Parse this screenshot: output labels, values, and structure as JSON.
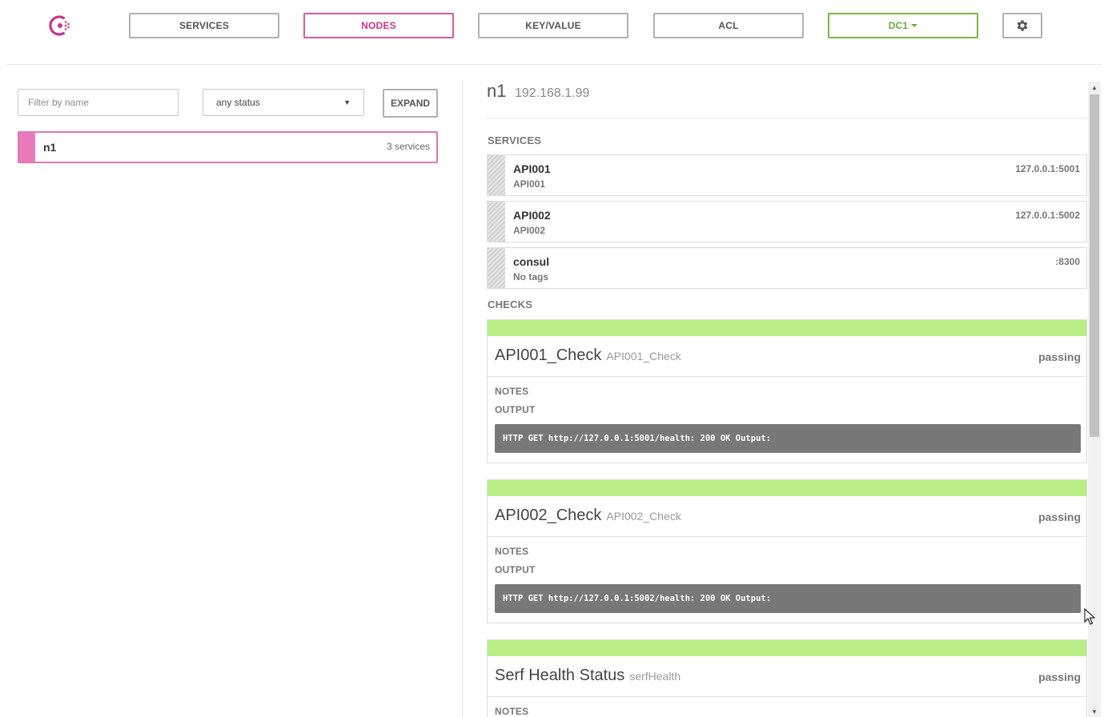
{
  "nav": {
    "services": "SERVICES",
    "nodes": "NODES",
    "keyvalue": "KEY/VALUE",
    "acl": "ACL",
    "datacenter": "DC1"
  },
  "colors": {
    "brand": "#c7358a",
    "active_border": "#d6599e",
    "dc_green": "#6aa93b",
    "passing_bar": "#b9ee87",
    "output_bg": "#787878"
  },
  "filters": {
    "name_placeholder": "Filter by name",
    "status_value": "any status",
    "expand_label": "EXPAND"
  },
  "nodes": [
    {
      "name": "n1",
      "services": "3 services"
    }
  ],
  "detail": {
    "name": "n1",
    "address": "192.168.1.99",
    "services_title": "SERVICES",
    "checks_title": "CHECKS",
    "services": [
      {
        "name": "API001",
        "tags": "API001",
        "address": "127.0.0.1:5001"
      },
      {
        "name": "API002",
        "tags": "API002",
        "address": "127.0.0.1:5002"
      },
      {
        "name": "consul",
        "tags": "No tags",
        "address": ":8300"
      }
    ],
    "checks": [
      {
        "name": "API001_Check",
        "id": "API001_Check",
        "status": "passing",
        "notes_label": "NOTES",
        "output_label": "OUTPUT",
        "output": "HTTP GET http://127.0.0.1:5001/health: 200 OK Output:"
      },
      {
        "name": "API002_Check",
        "id": "API002_Check",
        "status": "passing",
        "notes_label": "NOTES",
        "output_label": "OUTPUT",
        "output": "HTTP GET http://127.0.0.1:5002/health: 200 OK Output:"
      },
      {
        "name": "Serf Health Status",
        "id": "serfHealth",
        "status": "passing",
        "notes_label": "NOTES"
      }
    ]
  }
}
